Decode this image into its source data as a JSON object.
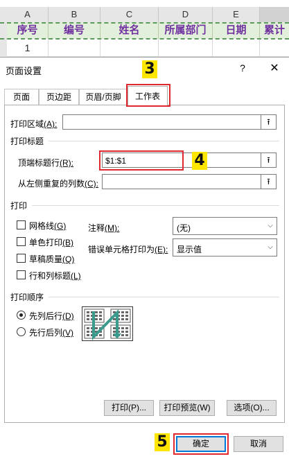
{
  "sheet": {
    "columns": [
      "A",
      "B",
      "C",
      "D",
      "E"
    ],
    "header_row": [
      "序号",
      "编号",
      "姓名",
      "所属部门",
      "日期",
      "累计"
    ],
    "data_row": [
      "1",
      "",
      "",
      "",
      "",
      ""
    ]
  },
  "dialog": {
    "title": "页面设置",
    "help": "?",
    "close": "✕",
    "tabs": [
      "页面",
      "页边距",
      "页眉/页脚",
      "工作表"
    ],
    "print_area": {
      "label": "打印区域",
      "key": "(A):",
      "value": ""
    },
    "print_titles": {
      "section": "打印标题",
      "top_rows_label": "顶端标题行",
      "top_rows_key": "(R):",
      "top_rows_value": "$1:$1",
      "left_cols_label": "从左侧重复的列数",
      "left_cols_key": "(C):",
      "left_cols_value": ""
    },
    "print": {
      "section": "打印",
      "gridlines": "网格线",
      "gridlines_key": "(G)",
      "mono": "单色打印",
      "mono_key": "(B)",
      "draft": "草稿质量",
      "draft_key": "(Q)",
      "headings": "行和列标题",
      "headings_key": "(L)",
      "comments_label": "注释",
      "comments_key": "(M):",
      "comments_value": "(无)",
      "errors_label": "错误单元格打印为",
      "errors_key": "(E):",
      "errors_value": "显示值"
    },
    "order": {
      "section": "打印顺序",
      "down_then_over": "先列后行",
      "down_then_over_key": "(D)",
      "over_then_down": "先行后列",
      "over_then_down_key": "(V)",
      "selected": "down_then_over"
    },
    "buttons": {
      "print": "打印(P)...",
      "preview": "打印预览(W)",
      "options": "选项(O)...",
      "ok": "确定",
      "cancel": "取消"
    },
    "range_button_glyph": "⭱"
  },
  "annotations": [
    "3",
    "4",
    "5"
  ],
  "colors": {
    "highlight": "#e0282e",
    "badge": "#ffe600",
    "header_fill": "#e2efda",
    "header_text": "#7030a0"
  }
}
